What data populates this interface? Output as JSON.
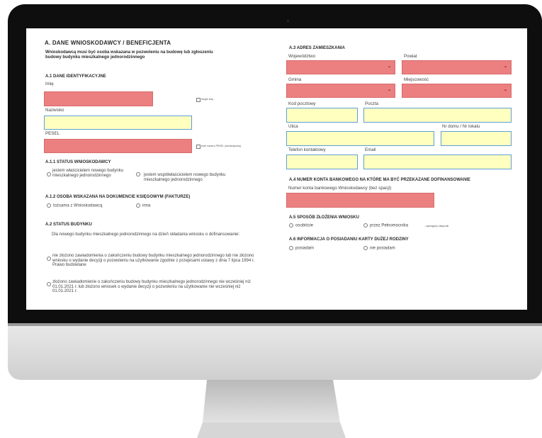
{
  "left": {
    "section_a": "A.  DANE WNIOSKODAWCY / BENEFICJENTA",
    "intro_note": "Wnioskodawcą musi być osoba wskazana w pozwoleniu na budowę lub zgłoszeniu budowy budynku mieszkalnego jednorodzinnego",
    "a1_title": "A.1  DANE IDENTYFIKACYJNE",
    "imie_label": "Imię",
    "drugie_imie_label": "drugie imię",
    "nazwisko_label": "Nazwisko",
    "pesel_label": "PESEL",
    "brak_pesel_label": "brak numeru PESEL (obcokrajowcy)",
    "a11_title": "A.1.1  STATUS WNIOSKODAWCY",
    "status_opt1": "jestem właścicielem nowego budynku mieszkalnego jednorodzinnego",
    "status_opt2": "jestem współwłaścicielem nowego budynku mieszkalnego jednorodzinnego",
    "a12_title": "A.1.2  OSOBA WSKAZANA NA DOKUMENCIE KSIĘGOWYM (FAKTURZE)",
    "osoba_opt1": "tożsama z Wnioskodawcą",
    "osoba_opt2": "inna",
    "a2_title": "A.2  STATUS BUDYNKU",
    "a2_intro": "Dla nowego budynku mieszkalnego jednorodzinnego na dzień składania wniosku o dofinansowanie:",
    "a2_opt1": "nie złożono zawiadomienia o zakończeniu budowy budynku mieszkalnego jednorodzinnego lub nie złożono wniosku o wydanie decyzji o pozwoleniu na użytkowanie zgodnie z przepisami ustawy z dnia 7 lipca 1994 r. Prawo budowlane",
    "a2_opt2": "złożono zawiadomienie o zakończeniu budowy budynku mieszkalnego jednorodzinnego nie wcześniej niż 01.01.2021 r. lub złożono wniosek o wydanie decyzji o pozwoleniu na użytkowanie nie wcześniej niż 01.01.2021 r."
  },
  "right": {
    "a3_title": "A.3  ADRES ZAMIESZKANIA",
    "wojewodztwo_label": "Województwo",
    "powiat_label": "Powiat",
    "gmina_label": "Gmina",
    "miejscowosc_label": "Miejscowość",
    "kod_label": "Kod pocztowy",
    "poczta_label": "Poczta",
    "ulica_label": "Ulica",
    "nr_domu_label": "Nr domu / Nr lokalu",
    "telefon_label": "Telefon kontaktowy",
    "email_label": "Email",
    "a4_title": "A.4  NUMER KONTA BANKOWEGO NA KTÓRE MA BYĆ PRZEKAZANE DOFINANSOWANIE",
    "konto_label": "Numer konta bankowego Wnioskodawcy (bez spacji)",
    "a5_title": "A.5  SPOSÓB ZŁOŻENIA WNIOSKU",
    "sposob_opt1": "osobiście",
    "sposob_opt2": "przez Pełnomocnika",
    "sposob_note": "- wymagany załącznik",
    "a6_title": "A.6  INFORMACJA O POSIADANIU KARTY DUŻEJ RODZINY",
    "karta_opt1": "posiadam",
    "karta_opt2": "nie posiadam"
  },
  "icons": {
    "chevron": "chevron-down-icon"
  },
  "colors": {
    "required_field": "#ec8080",
    "filled_field": "#ffffc0",
    "field_border": "#5f9fd6"
  }
}
